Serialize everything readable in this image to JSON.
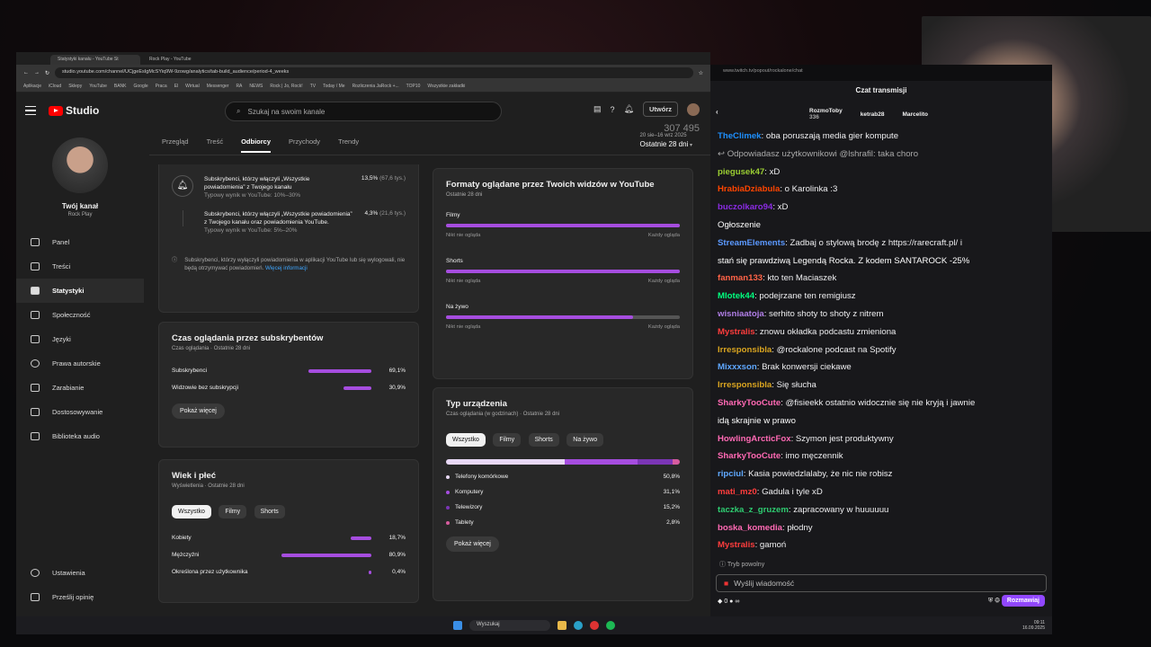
{
  "browser": {
    "tabs": [
      "Statystyki kanału - YouTube St",
      "Rock Play - YouTube"
    ],
    "url": "studio.youtube.com/channel/UCjgeEsIgMcSYiq9W-9zowg/analytics/tab-build_audience/period-4_weeks",
    "bookmarks": [
      "Aplikacje",
      "iCloud",
      "Sklepy",
      "YouTube",
      "BANK",
      "Google",
      "Praca",
      "El",
      "Wirtual",
      "Messenger",
      "RA",
      "NEWS",
      "Rock | Jo, Rock!",
      "TV",
      "Today / Me",
      "Rozliczenia JaRock +...",
      "TOP10",
      "Wszystkie zakładki"
    ]
  },
  "yt": {
    "logo_text": "Studio",
    "search_placeholder": "Szukaj na swoim kanale",
    "create_label": "Utwórz",
    "channel_name": "Twój kanał",
    "channel_sub": "Rock Play",
    "nav": [
      "Panel",
      "Treści",
      "Statystyki",
      "Społeczność",
      "Języki",
      "Prawa autorskie",
      "Zarabianie",
      "Dostosowywanie",
      "Biblioteka audio"
    ],
    "nav_bottom": [
      "Ustawienia",
      "Prześlij opinię"
    ],
    "tabs": [
      "Przegląd",
      "Treść",
      "Odbiorcy",
      "Przychody",
      "Trendy"
    ],
    "period_range": "20 sie–16 wrz 2025",
    "period_label": "Ostatnie 28 dni",
    "ghost_number": "307 495"
  },
  "notif": {
    "r1_text": "Subskrybenci, którzy włączyli „Wszystkie powiadomienia” z Twojego kanału",
    "r1_typ": "Typowy wynik w YouTube: 10%–30%",
    "r1_val": "13,5%",
    "r1_sub": "(67,6 tys.)",
    "r2_text": "Subskrybenci, którzy włączyli „Wszystkie powiadomienia” z Twojego kanału oraz powiadomienia YouTube.",
    "r2_typ": "Typowy wynik w YouTube: 5%–20%",
    "r2_val": "4,3%",
    "r2_sub": "(21,6 tys.)",
    "info": "Subskrybenci, którzy wyłączyli powiadomienia w aplikacji YouTube lub się wylogowali, nie będą otrzymywać powiadomień.",
    "link": "Więcej informacji"
  },
  "watch": {
    "title": "Czas oglądania przez subskrybentów",
    "sub": "Czas oglądania · Ostatnie 28 dni",
    "rows": [
      {
        "label": "Subskrybenci",
        "value": "69,1%",
        "pct": 69.1
      },
      {
        "label": "Widzowie bez subskrypcji",
        "value": "30,9%",
        "pct": 30.9
      }
    ],
    "more": "Pokaż więcej"
  },
  "age": {
    "title": "Wiek i płeć",
    "sub": "Wyświetlenia · Ostatnie 28 dni",
    "pills": [
      "Wszystko",
      "Filmy",
      "Shorts"
    ],
    "rows": [
      {
        "label": "Kobiety",
        "value": "18,7%",
        "pct": 18.7
      },
      {
        "label": "Mężczyźni",
        "value": "80,9%",
        "pct": 80.9
      },
      {
        "label": "Określona przez użytkownika",
        "value": "0,4%",
        "pct": 0.4
      }
    ]
  },
  "formats": {
    "title": "Formaty oglądane przez Twoich widzów w YouTube",
    "sub": "Ostatnie 28 dni",
    "low": "Nikt nie ogląda",
    "high": "Każdy ogląda",
    "rows": [
      {
        "label": "Filmy",
        "fill": 1.0
      },
      {
        "label": "Shorts",
        "fill": 1.0
      },
      {
        "label": "Na żywo",
        "fill": 0.8
      }
    ]
  },
  "device": {
    "title": "Typ urządzenia",
    "sub": "Czas oglądania (w godzinach) · Ostatnie 28 dni",
    "pills": [
      "Wszystko",
      "Filmy",
      "Shorts",
      "Na żywo"
    ],
    "rows": [
      {
        "label": "Telefony komórkowe",
        "value": "50,8%",
        "color": "#e8d8f5"
      },
      {
        "label": "Komputery",
        "value": "31,1%",
        "color": "#a64ddf"
      },
      {
        "label": "Telewizory",
        "value": "15,2%",
        "color": "#7b35b5"
      },
      {
        "label": "Tablety",
        "value": "2,8%",
        "color": "#d65c9e"
      }
    ],
    "more": "Pokaż więcej"
  },
  "chat": {
    "popout_url": "www.twitch.tv/popout/rockalone/chat",
    "header": "Czat transmisji",
    "gifts": [
      {
        "name": "RozmoToby",
        "count": "336"
      },
      {
        "name": "ketrab28",
        "count": ""
      },
      {
        "name": "Marcelito",
        "count": ""
      }
    ],
    "messages": [
      {
        "user": "TheClimek",
        "color": "#1e90ff",
        "text": ": oba poruszają media gier kompute"
      },
      {
        "user": "",
        "color": "#aaa",
        "text": "↩ Odpowiadasz użytkownikowi @lshrafil: taka choro"
      },
      {
        "user": "piegusek47",
        "color": "#9acd32",
        "text": ": xD"
      },
      {
        "user": "HrabiaDziabula",
        "color": "#ff4500",
        "text": ": o Karolinka :3"
      },
      {
        "user": "buczolkaro94",
        "color": "#8a2be2",
        "text": ": xD"
      },
      {
        "user": "",
        "color": "#fff",
        "text": "Ogłoszenie"
      },
      {
        "user": "StreamElements",
        "color": "#5b99ff",
        "text": ": Zadbaj o stylową brodę z https://rarecraft.pl/ i"
      },
      {
        "user": "",
        "color": "#fff",
        "text": "stań się prawdziwą Legendą Rocka. Z kodem SANTAROCK -25%"
      },
      {
        "user": "fanman133",
        "color": "#ff6347",
        "text": ": kto ten Maciaszek"
      },
      {
        "user": "Mlotek44",
        "color": "#00ff7f",
        "text": ": podejrzane ten remigiusz"
      },
      {
        "user": "wisniaatoja",
        "color": "#b07ee6",
        "text": ": serhito shoty to shoty z nitrem"
      },
      {
        "user": "Mystralis",
        "color": "#ff3d3d",
        "text": ": znowu okładka podcastu zmieniona"
      },
      {
        "user": "Irresponsibla",
        "color": "#daa520",
        "text": ": @rockalone podcast na Spotify"
      },
      {
        "user": "Mixxxson",
        "color": "#5fa8ff",
        "text": ": Brak konwersji ciekawe"
      },
      {
        "user": "Irresponsibla",
        "color": "#daa520",
        "text": ": Się słucha"
      },
      {
        "user": "SharkyTooCute",
        "color": "#ff69b4",
        "text": ": @fisieekk ostatnio widocznie się nie kryją i jawnie"
      },
      {
        "user": "",
        "color": "#fff",
        "text": "idą skrajnie w prawo"
      },
      {
        "user": "HowlingArcticFox",
        "color": "#ff69b4",
        "text": ": Szymon jest produktywny"
      },
      {
        "user": "SharkyTooCute",
        "color": "#ff69b4",
        "text": ": imo męczennik"
      },
      {
        "user": "ripciul",
        "color": "#5fa8ff",
        "text": ": Kasia powiedzlalaby, że nic nie robisz"
      },
      {
        "user": "mati_mz0",
        "color": "#ff3d3d",
        "text": ": Gadula i tyle xD"
      },
      {
        "user": "taczka_z_gruzem",
        "color": "#2ecc71",
        "text": ": zapracowany w huuuuuu"
      },
      {
        "user": "boska_komedia",
        "color": "#ff69b4",
        "text": ": płodny"
      },
      {
        "user": "Mystralis",
        "color": "#ff3d3d",
        "text": ": gamoń"
      }
    ],
    "slow_mode": "Tryb powolny",
    "input_placeholder": "Wyślij wiadomość",
    "points": "0",
    "talk_button": "Rozmawiaj"
  },
  "taskbar": {
    "search": "Wyszukaj",
    "time": "09:11",
    "date": "16.09.2025"
  }
}
